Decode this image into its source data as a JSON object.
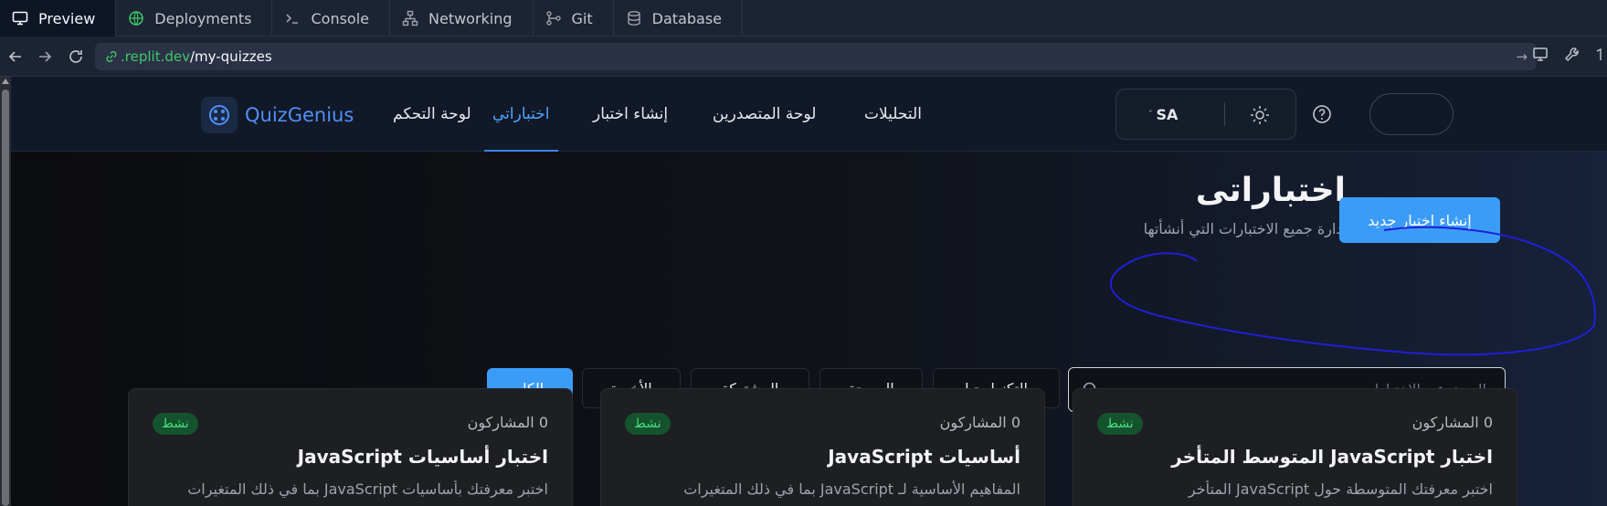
{
  "tabs": [
    {
      "label": "Preview",
      "icon": "monitor-icon",
      "active": true
    },
    {
      "label": "Deployments",
      "icon": "globe-icon"
    },
    {
      "label": "Console",
      "icon": "terminal-icon"
    },
    {
      "label": "Networking",
      "icon": "network-icon"
    },
    {
      "label": "Git",
      "icon": "git-icon"
    },
    {
      "label": "Database",
      "icon": "database-icon"
    }
  ],
  "url": {
    "host": ".replit.dev",
    "path": "/my-quizzes"
  },
  "app": {
    "logo": "QuizGenius",
    "nav": {
      "dashboard": "لوحة التحكم",
      "my_quizzes": "اختباراتي",
      "create_quiz": "إنشاء اختبار",
      "leaderboard": "لوحة المتصدرين",
      "analytics": "التحليلات"
    },
    "language": "SA"
  },
  "page": {
    "title": "اختباراتى",
    "subtitle": "إدارة جميع الاختبارات التي أنشأتها",
    "create_button": "إنشاء اختبار جديد",
    "search_placeholder": "البحث عن الاختبارات...",
    "filters": {
      "all": "الكل",
      "recent": "الأخيرة",
      "shared": "المشتركة",
      "programming": "البرمجة",
      "technology": "التكنولوجيا"
    }
  },
  "quizzes": [
    {
      "status": "نشط",
      "participants": "0 المشاركون",
      "title": "اختبار JavaScript المتوسط المتأخر",
      "description": "اختبر معرفتك المتوسطة حول JavaScript المتأخر"
    },
    {
      "status": "نشط",
      "participants": "0 المشاركون",
      "title": "أساسيات JavaScript",
      "description": "المفاهيم الأساسية لـ JavaScript بما في ذلك المتغيرات"
    },
    {
      "status": "نشط",
      "participants": "0 المشاركون",
      "title": "اختبار أساسيات JavaScript",
      "description": "اختبر معرفتك بأساسيات JavaScript بما في ذلك المتغيرات"
    }
  ],
  "colors": {
    "accent": "#3b9cf7",
    "annotation": "#1f1fd6",
    "active_badge": "#14532d"
  }
}
